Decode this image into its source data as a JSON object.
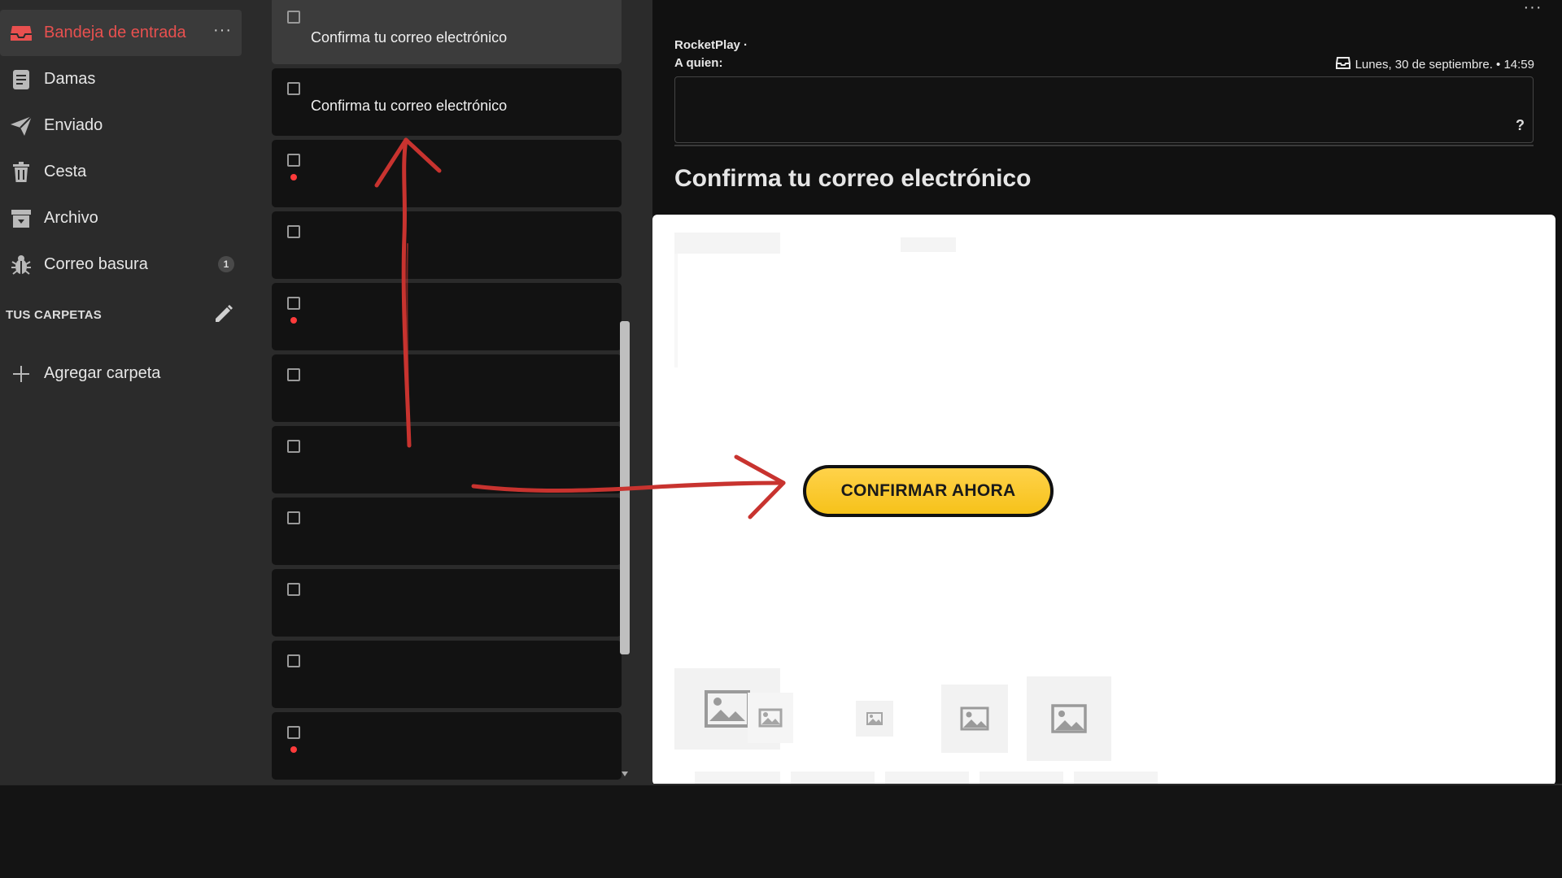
{
  "sidebar": {
    "items": [
      {
        "label": "Bandeja de entrada",
        "icon": "inbox-icon",
        "active": true
      },
      {
        "label": "Damas",
        "icon": "document-icon"
      },
      {
        "label": "Enviado",
        "icon": "send-icon"
      },
      {
        "label": "Cesta",
        "icon": "trash-icon"
      },
      {
        "label": "Archivo",
        "icon": "archive-icon"
      },
      {
        "label": "Correo basura",
        "icon": "bug-icon",
        "badge": "1"
      }
    ],
    "more_label": "···",
    "folders_header": "TUS CARPETAS",
    "add_folder_label": "Agregar carpeta"
  },
  "email_list": {
    "rows": [
      {
        "subject": "Confirma tu correo electrónico",
        "unread": false,
        "selected": true
      },
      {
        "subject": "Confirma tu correo electrónico",
        "unread": false
      },
      {
        "subject": "",
        "unread": true
      },
      {
        "subject": "",
        "unread": false
      },
      {
        "subject": "",
        "unread": true
      },
      {
        "subject": "",
        "unread": false
      },
      {
        "subject": "",
        "unread": false
      },
      {
        "subject": "",
        "unread": false
      },
      {
        "subject": "",
        "unread": false
      },
      {
        "subject": "",
        "unread": false
      },
      {
        "subject": "",
        "unread": true
      }
    ]
  },
  "reading": {
    "more_label": "···",
    "sender": "RocketPlay ·",
    "to_label": "A quien:",
    "date": "Lunes, 30 de septiembre. • 14:59",
    "reply_help": "?",
    "subject": "Confirma tu correo electrónico",
    "cta_label": "CONFIRMAR AHORA"
  },
  "colors": {
    "accent": "#e8504f",
    "cta": "#f6c21a",
    "unread_dot": "#ff3b3b",
    "annotation_arrow": "#c8332f"
  }
}
